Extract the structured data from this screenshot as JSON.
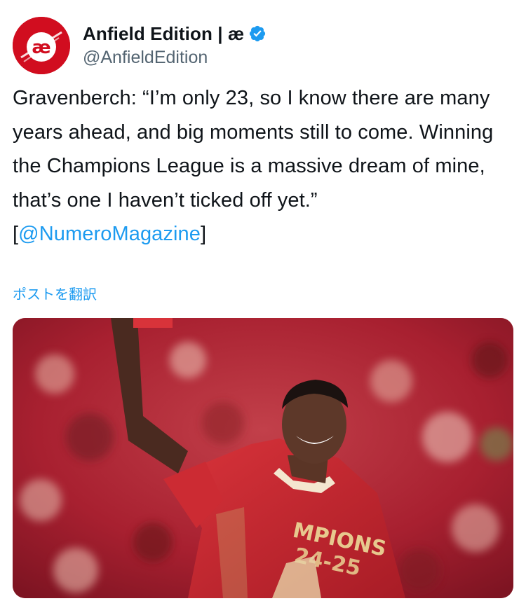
{
  "author": {
    "display_name": "Anfield Edition | æ",
    "handle": "@AnfieldEdition",
    "avatar_text": "æ",
    "verified": true
  },
  "tweet": {
    "text_before_mention": "Gravenberch: “I’m only 23, so I know there are many years ahead, and big moments still to come. Winning the Champions League is a massive dream of mine, that’s one I haven’t ticked off yet.” [",
    "mention": "@NumeroMagazine",
    "text_after_mention": "]",
    "translate_label": "ポストを翻訳"
  },
  "media": {
    "shirt_text_line1": "MPIONS",
    "shirt_text_line2": "24-25"
  },
  "colors": {
    "accent": "#1d9bf0",
    "brand_red": "#d10d1f",
    "text_primary": "#0f1419",
    "text_secondary": "#536471"
  }
}
